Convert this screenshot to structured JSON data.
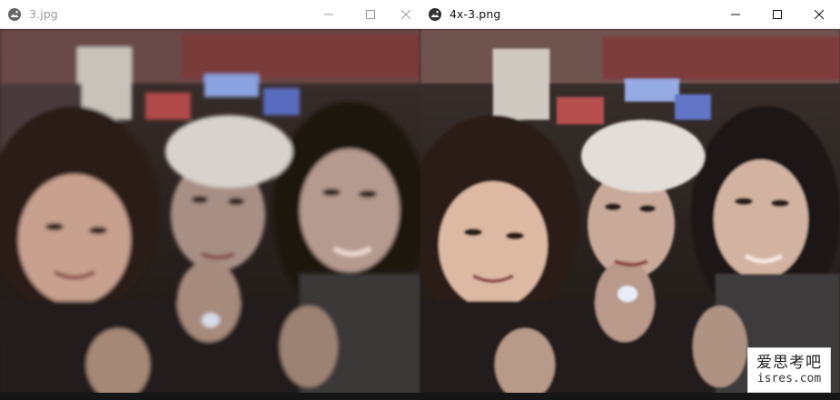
{
  "windows": [
    {
      "title": "3.jpg",
      "icon": "photos-app-icon",
      "state": "inactive"
    },
    {
      "title": "4x-3.png",
      "icon": "photos-app-icon",
      "state": "active"
    }
  ],
  "watermark": {
    "line1": "爱思考吧",
    "line2": "isres.com"
  },
  "colors": {
    "titlebar_bg": "#ffffff",
    "inactive_text": "#9a9a9a",
    "active_text": "#111111"
  }
}
